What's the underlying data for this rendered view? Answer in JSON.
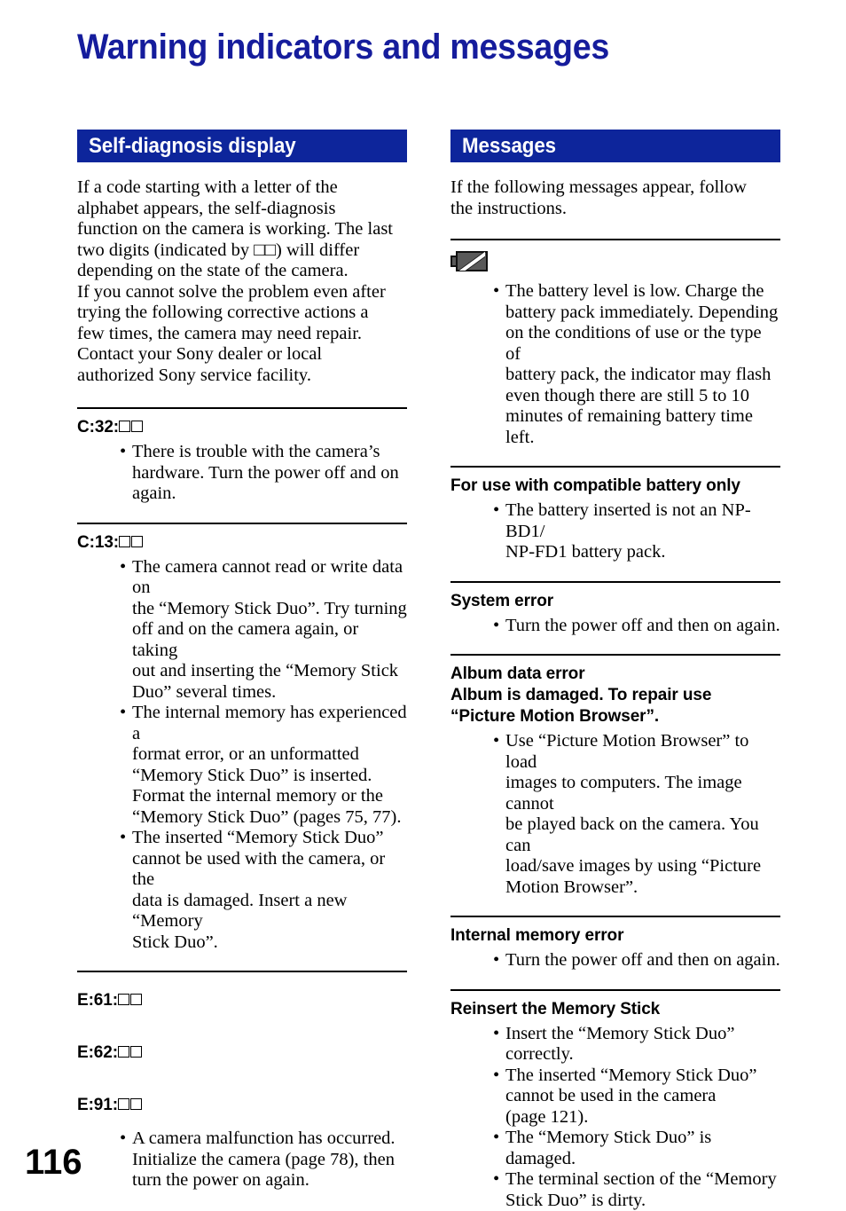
{
  "document": {
    "title": "Warning indicators and messages",
    "page_number": "116",
    "title_color": "#151c9c",
    "bar_color": "#0d259b"
  },
  "left_column": {
    "section_header": "Self-diagnosis display",
    "intro": [
      "If a code starting with a letter of the",
      "alphabet appears, the self-diagnosis",
      "function on the camera is working. The last",
      "two digits (indicated by □□) will differ",
      "depending on the state of the camera.",
      "If you cannot solve the problem even after",
      "trying the following corrective actions a",
      "few times, the camera may need repair.",
      "Contact your Sony dealer or local",
      "authorized Sony service facility."
    ],
    "sections": [
      {
        "headings": [
          {
            "text": "C:32:",
            "boxes": 2
          }
        ],
        "bullets": [
          [
            "There is trouble with the camera’s",
            "hardware. Turn the power off and on",
            "again."
          ]
        ]
      },
      {
        "headings": [
          {
            "text": "C:13:",
            "boxes": 2
          }
        ],
        "bullets": [
          [
            "The camera cannot read or write data on",
            "the “Memory Stick Duo”. Try turning",
            "off and on the camera again, or taking",
            "out and inserting the “Memory Stick",
            "Duo” several times."
          ],
          [
            "The internal memory has experienced a",
            "format error, or an unformatted",
            "“Memory Stick Duo” is inserted.",
            "Format the internal memory or the",
            "“Memory Stick Duo” (pages 75, 77)."
          ],
          [
            "The inserted “Memory Stick Duo”",
            "cannot be used with the camera, or the",
            "data is damaged. Insert a new “Memory",
            "Stick Duo”."
          ]
        ]
      },
      {
        "headings": [
          {
            "text": "E:61:",
            "boxes": 2
          },
          {
            "text": "E:62:",
            "boxes": 2
          },
          {
            "text": "E:91:",
            "boxes": 2
          }
        ],
        "bullets": [
          [
            "A camera malfunction has occurred.",
            "Initialize the camera (page 78), then",
            "turn the power on again."
          ]
        ]
      }
    ]
  },
  "right_column": {
    "section_header": "Messages",
    "intro": [
      "If the following messages appear, follow",
      "the instructions."
    ],
    "sections": [
      {
        "icon": "low-battery-icon",
        "headings": [],
        "bullets": [
          [
            "The battery level is low. Charge the",
            "battery pack immediately. Depending",
            "on the conditions of use or the type of",
            "battery pack, the indicator may flash",
            "even though there are still 5 to 10",
            "minutes of remaining battery time left."
          ]
        ]
      },
      {
        "headings": [
          {
            "text": "For use with compatible battery only",
            "boxes": 0
          }
        ],
        "bullets": [
          [
            "The battery inserted is not an NP-BD1/",
            "NP-FD1 battery pack."
          ]
        ]
      },
      {
        "headings": [
          {
            "text": "System error",
            "boxes": 0
          }
        ],
        "bullets": [
          [
            "Turn the power off and then on again."
          ]
        ]
      },
      {
        "headings": [
          {
            "text": "Album data error",
            "boxes": 0
          },
          {
            "text": "Album is damaged. To repair use",
            "boxes": 0
          },
          {
            "text": "“Picture Motion Browser”.",
            "boxes": 0
          }
        ],
        "bullets": [
          [
            "Use “Picture Motion Browser” to load",
            "images to computers. The image cannot",
            "be played back on the camera. You can",
            "load/save images by using “Picture",
            "Motion Browser”."
          ]
        ]
      },
      {
        "headings": [
          {
            "text": "Internal memory error",
            "boxes": 0
          }
        ],
        "bullets": [
          [
            "Turn the power off and then on again."
          ]
        ]
      },
      {
        "headings": [
          {
            "text": "Reinsert the Memory Stick",
            "boxes": 0
          }
        ],
        "bullets": [
          [
            "Insert the “Memory Stick Duo”",
            "correctly."
          ],
          [
            "The inserted “Memory Stick Duo”",
            "cannot be used in the camera",
            "(page 121)."
          ],
          [
            "The “Memory Stick Duo” is damaged."
          ],
          [
            "The terminal section of the “Memory",
            "Stick Duo” is dirty."
          ]
        ]
      }
    ]
  }
}
